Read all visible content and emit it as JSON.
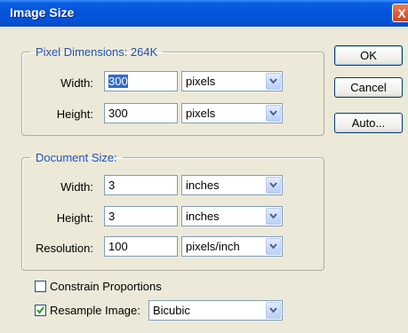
{
  "window": {
    "title": "Image Size",
    "close_glyph": "X"
  },
  "pixel_dimensions": {
    "legend": "Pixel Dimensions:  264K",
    "width_label": "Width:",
    "width_value": "300",
    "width_unit": "pixels",
    "height_label": "Height:",
    "height_value": "300",
    "height_unit": "pixels"
  },
  "document_size": {
    "legend": "Document Size:",
    "width_label": "Width:",
    "width_value": "3",
    "width_unit": "inches",
    "height_label": "Height:",
    "height_value": "3",
    "height_unit": "inches",
    "resolution_label": "Resolution:",
    "resolution_value": "100",
    "resolution_unit": "pixels/inch"
  },
  "options": {
    "constrain_label": "Constrain Proportions",
    "constrain_checked": false,
    "resample_label": "Resample Image:",
    "resample_checked": true,
    "resample_method": "Bicubic"
  },
  "buttons": {
    "ok": "OK",
    "cancel": "Cancel",
    "auto": "Auto..."
  },
  "colors": {
    "title_bar": "#0353d8",
    "legend_text": "#1f4fb4",
    "dialog_bg": "#ece9d8",
    "selection": "#316ac5"
  }
}
